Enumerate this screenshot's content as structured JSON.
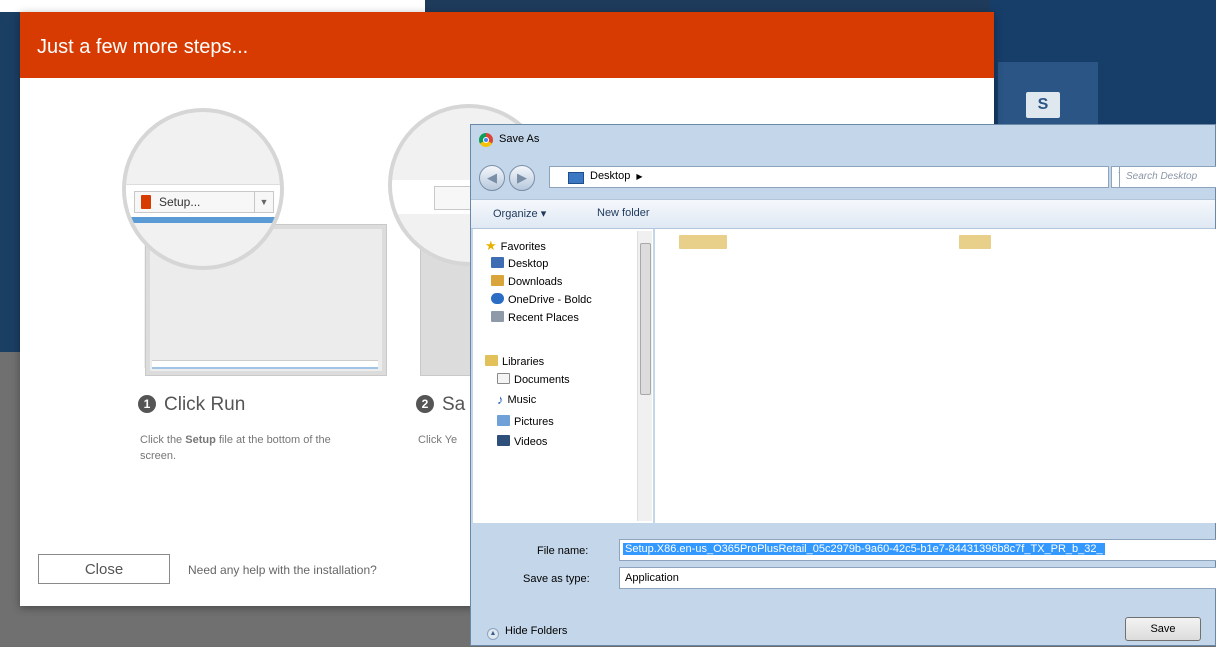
{
  "installer": {
    "title": "Just a few more steps...",
    "download_item": "Setup...",
    "step1": {
      "number": "1",
      "title": "Click Run",
      "desc_prefix": "Click the ",
      "desc_bold": "Setup",
      "desc_suffix": " file at the bottom of the screen."
    },
    "step2": {
      "number": "2",
      "title": "Sa",
      "desc": "Click Ye"
    },
    "close_label": "Close",
    "help_text": "Need any help with the installation?"
  },
  "save_as": {
    "title": "Save As",
    "address": "Desktop",
    "search_placeholder": "Search Desktop",
    "toolbar": {
      "organize": "Organize ▾",
      "new_folder": "New folder"
    },
    "nav_items": [
      {
        "label": "Favorites",
        "icon": "star-icon"
      },
      {
        "label": "Desktop",
        "icon": "desktop-icon"
      },
      {
        "label": "Downloads",
        "icon": "downloads-icon"
      },
      {
        "label": "OneDrive - Boldc",
        "icon": "onedrive-icon"
      },
      {
        "label": "Recent Places",
        "icon": "recent-places-icon"
      },
      {
        "label": "Libraries",
        "icon": "libraries-icon"
      },
      {
        "label": "Documents",
        "icon": "documents-icon"
      },
      {
        "label": "Music",
        "icon": "music-icon"
      },
      {
        "label": "Pictures",
        "icon": "pictures-icon"
      },
      {
        "label": "Videos",
        "icon": "videos-icon"
      }
    ],
    "file_name_label": "File name:",
    "file_name_value": "Setup.X86.en-us_O365ProPlusRetail_05c2979b-9a60-42c5-b1e7-84431396b8c7f_TX_PR_b_32_",
    "save_type_label": "Save as type:",
    "save_type_value": "Application",
    "hide_folders": "Hide Folders",
    "save_button": "Save"
  },
  "colors": {
    "office_orange": "#d83b01",
    "desktop_navy": "#173d69",
    "dialog_frame": "#c4d6ea",
    "selection_blue": "#3399ff"
  }
}
